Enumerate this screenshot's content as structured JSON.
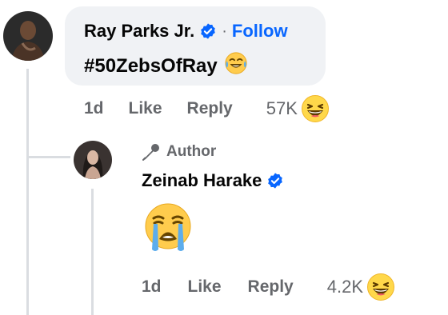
{
  "comment": {
    "author": "Ray Parks Jr.",
    "verified": true,
    "separator": "·",
    "follow_label": "Follow",
    "text": "#50ZebsOfRay",
    "text_emoji": "face-with-tears-of-joy-icon",
    "time": "1d",
    "like_label": "Like",
    "reply_label": "Reply",
    "reaction_count": "57K",
    "reaction_icon": "haha-reaction-icon"
  },
  "reply": {
    "badge_label": "Author",
    "author": "Zeinab Harake",
    "verified": true,
    "content_emoji": "loudly-crying-face-icon",
    "time": "1d",
    "like_label": "Like",
    "reply_label": "Reply",
    "reaction_count": "4.2K",
    "reaction_icon": "haha-reaction-icon"
  },
  "colors": {
    "link_blue": "#0866ff",
    "verified_blue": "#0866ff",
    "muted_text": "#65676b",
    "bubble_bg": "#f0f2f5",
    "thread_line": "#dadde1"
  }
}
